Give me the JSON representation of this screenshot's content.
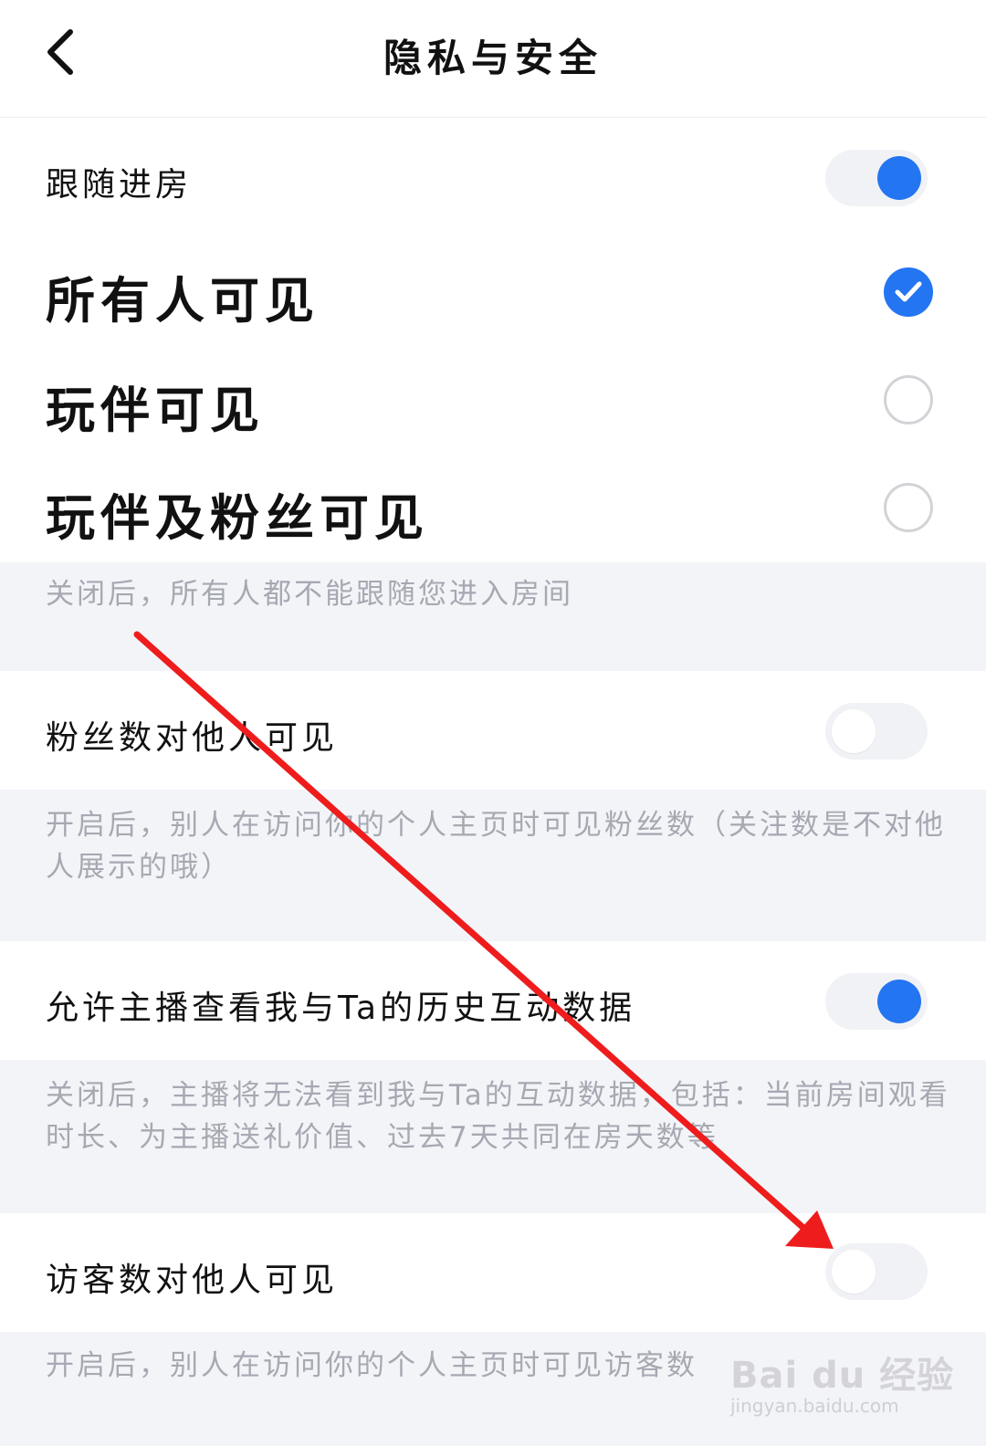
{
  "header": {
    "title": "隐私与安全"
  },
  "follow_room": {
    "label": "跟随进房",
    "toggle_on": true,
    "options": [
      {
        "label": "所有人可见",
        "selected": true
      },
      {
        "label": "玩伴可见",
        "selected": false
      },
      {
        "label": "玩伴及粉丝可见",
        "selected": false
      }
    ],
    "description": "关闭后，所有人都不能跟随您进入房间"
  },
  "fans_visible": {
    "label": "粉丝数对他人可见",
    "toggle_on": false,
    "description": "开启后，别人在访问你的个人主页时可见粉丝数（关注数是不对他人展示的哦）"
  },
  "history_interaction": {
    "label": "允许主播查看我与Ta的历史互动数据",
    "toggle_on": true,
    "description": "关闭后，主播将无法看到我与Ta的互动数据，包括：当前房间观看时长、为主播送礼价值、过去7天共同在房天数等"
  },
  "visitors_visible": {
    "label": "访客数对他人可见",
    "toggle_on": false,
    "description": "开启后，别人在访问你的个人主页时可见访客数"
  },
  "colors": {
    "accent": "#2475f2",
    "annotation_arrow": "#ee1c1c",
    "section_background": "#f3f4f8",
    "description_text": "#a6a9b2"
  },
  "watermark": {
    "brand": "Bai du 经验",
    "url": "jingyan.baidu.com"
  }
}
